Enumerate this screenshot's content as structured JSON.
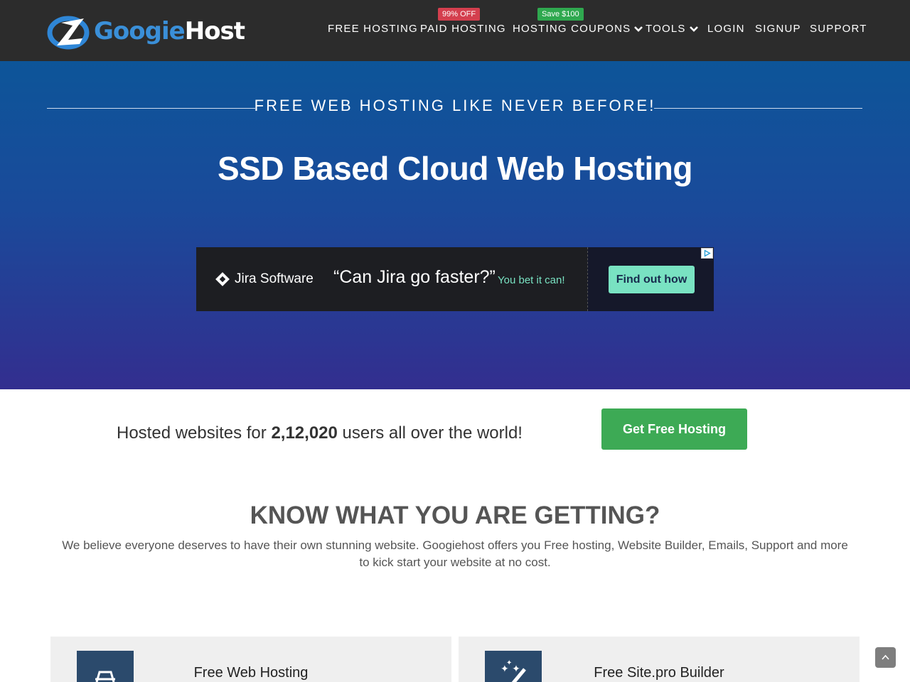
{
  "logo": {
    "part_a": "Googie",
    "part_b": "Host"
  },
  "nav": {
    "items": [
      {
        "label": "FREE HOSTING"
      },
      {
        "label": "PAID HOSTING",
        "badge": "99% OFF"
      },
      {
        "label": "HOSTING COUPONS",
        "badge": "Save $100"
      },
      {
        "label": "TOOLS"
      },
      {
        "label": "LOGIN"
      },
      {
        "label": "SIGNUP"
      },
      {
        "label": "SUPPORT"
      }
    ]
  },
  "hero": {
    "kicker": "FREE WEB HOSTING LIKE NEVER BEFORE!",
    "title": "SSD Based Cloud Web Hosting"
  },
  "ad": {
    "brand": "Jira Software",
    "quote": "“Can Jira go faster?”",
    "sub": "You bet it can!",
    "button": "Find out how"
  },
  "users": {
    "prefix": "Hosted websites for",
    "count": "2,12,020",
    "suffix": "users all over the world!",
    "cta": "Get Free Hosting"
  },
  "know": {
    "title": "KNOW WHAT YOU ARE GETTING?",
    "description": "We believe everyone deserves to have their own stunning website. Googiehost offers you Free hosting, Website Builder, Emails, Support and more to kick start your website at no cost."
  },
  "features": [
    {
      "title": "Free Web Hosting",
      "icon": "server-drive-icon"
    },
    {
      "title": "Free Site.pro Builder",
      "icon": "magic-wand-icon"
    }
  ],
  "colors": {
    "nav_bg": "#2c2c2c",
    "hero_top": "#0d5599",
    "hero_bottom": "#332e8f",
    "cta_green": "#3daa55",
    "badge_red": "#d43f4e",
    "badge_green": "#2fa84f",
    "logo_blue": "#3a8fd8"
  }
}
